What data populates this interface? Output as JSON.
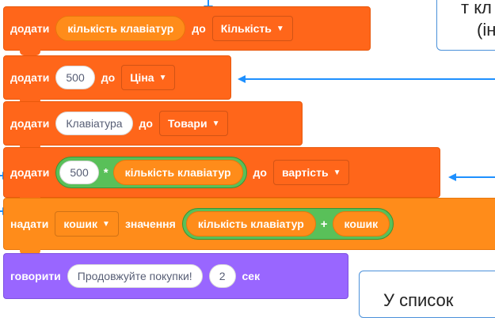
{
  "colors": {
    "data_block": "#FF661A",
    "reporter": "#FF8C1A",
    "operator": "#59C059",
    "looks_block": "#9966FF",
    "arrow": "#1E90FF"
  },
  "blocks": [
    {
      "label": "додати",
      "input": "кількість клавіатур",
      "connector": "до",
      "target": "Кількість"
    },
    {
      "label": "додати",
      "input": "500",
      "connector": "до",
      "target": "Ціна"
    },
    {
      "label": "додати",
      "input": "Клавіатура",
      "connector": "до",
      "target": "Товари"
    },
    {
      "label": "додати",
      "left": "500",
      "operator": "*",
      "right": "кількість клавіатур",
      "connector": "до",
      "target": "вартість"
    },
    {
      "label": "надати",
      "variable": "кошик",
      "connector": "значення",
      "left": "кількість клавіатур",
      "operator": "+",
      "right": "кошик"
    },
    {
      "label": "говорити",
      "message": "Продовжуйте покупки!",
      "seconds": "2",
      "unit": "сек"
    }
  ],
  "notes": {
    "top_right_line1": "т кл",
    "top_right_line2": "(ін",
    "bottom_right": "У список"
  }
}
